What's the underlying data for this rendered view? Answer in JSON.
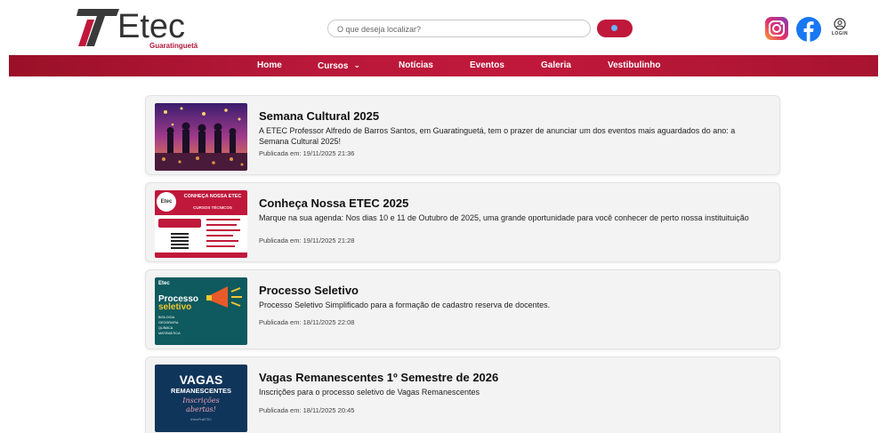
{
  "header": {
    "logo_text": "Etec",
    "logo_subtitle": "Guaratinguetá",
    "search_placeholder": "O que deseja localizar?",
    "login_label": "LOGIN",
    "colors": {
      "brand": "#c0183b",
      "dark_brand": "#9a1027"
    },
    "icons": [
      "instagram-icon",
      "facebook-icon",
      "login-icon",
      "search-icon"
    ]
  },
  "nav": {
    "items": [
      {
        "label": "Home"
      },
      {
        "label": "Cursos",
        "has_dropdown": true
      },
      {
        "label": "Notícias"
      },
      {
        "label": "Eventos"
      },
      {
        "label": "Galeria"
      },
      {
        "label": "Vestibulinho"
      }
    ]
  },
  "posts": [
    {
      "title": "Semana Cultural 2025",
      "description": "A ETEC Professor Alfredo de Barros Santos, em Guaratinguetá, tem o prazer de anunciar um dos eventos mais aguardados do ano: a Semana Cultural 2025!",
      "date": "Publicada em: 19/11/2025 21:36"
    },
    {
      "title": "Conheça Nossa ETEC 2025",
      "description": "Marque na sua agenda: Nos dias 10 e 11 de Outubro de 2025, uma grande oportunidade para você conhecer de perto nossa instituituição",
      "date": "Publicada em: 19/11/2025 21:28",
      "thumb": {
        "brand": "Etec",
        "heading": "CONHEÇA NOSSA ETEC",
        "subheading": "CURSOS TÉCNICOS"
      }
    },
    {
      "title": "Processo Seletivo",
      "description": "Processo Seletivo Simplificado para a formação de cadastro reserva de docentes.",
      "date": "Publicada em: 18/11/2025 22:08",
      "thumb": {
        "brand": "Etec",
        "line1": "Processo",
        "line2": "seletivo",
        "subjects": [
          "BIOLOGIA",
          "GEOGRAFIA",
          "QUÍMICA",
          "MATEMÁTICA"
        ]
      }
    },
    {
      "title": "Vagas Remanescentes 1º Semestre de 2026",
      "description": "Inscrições para o processo seletivo de Vagas Remanescentes",
      "date": "Publicada em: 18/11/2025 20:45",
      "thumb": {
        "line1": "VAGAS",
        "line2": "REMANESCENTES",
        "line3": "Inscrições",
        "line4": "abertas!",
        "tag": "#VemPraETEC"
      }
    }
  ]
}
